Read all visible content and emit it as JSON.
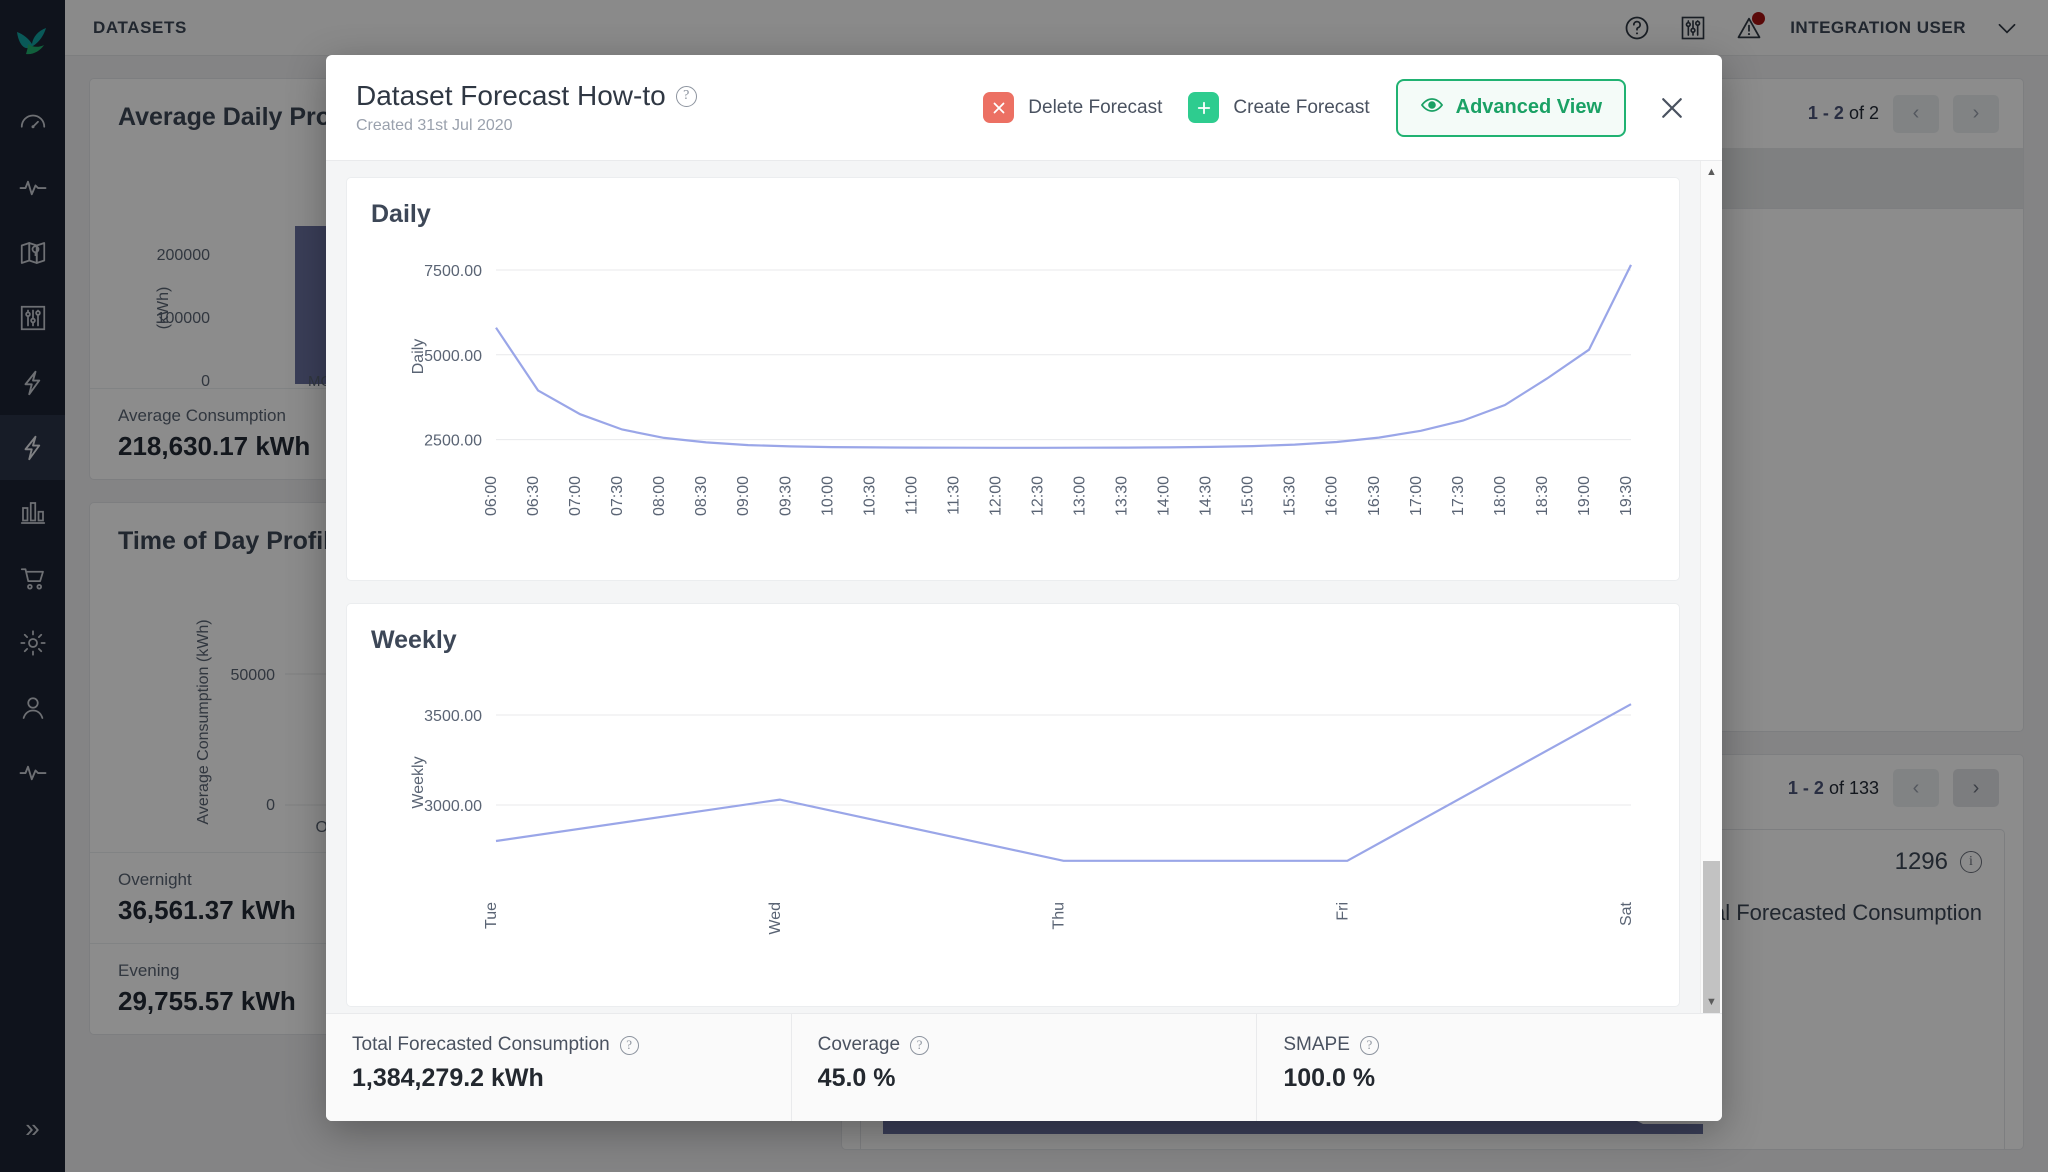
{
  "topbar": {
    "breadcrumb": "DATASETS",
    "user": "INTEGRATION USER",
    "icons": [
      "help-icon",
      "settings-sliders-icon",
      "alert-warning-icon",
      "chevron-down-icon"
    ]
  },
  "sidebar": {
    "items": [
      {
        "name": "logo",
        "label": "Logo"
      },
      {
        "name": "dashboard",
        "label": "Dashboard"
      },
      {
        "name": "activity",
        "label": "Activity"
      },
      {
        "name": "map",
        "label": "Map"
      },
      {
        "name": "controls",
        "label": "Controls"
      },
      {
        "name": "energy",
        "label": "Energy"
      },
      {
        "name": "datasets",
        "label": "Datasets"
      },
      {
        "name": "reports",
        "label": "Reports"
      },
      {
        "name": "marketplace",
        "label": "Marketplace"
      },
      {
        "name": "settings",
        "label": "Settings"
      },
      {
        "name": "users",
        "label": "Users"
      },
      {
        "name": "monitoring",
        "label": "Monitoring"
      }
    ],
    "expand_label": "»"
  },
  "background": {
    "card1": {
      "title": "Average Daily Profile",
      "stat_label": "Average Consumption",
      "stat_value": "218,630.17 kWh",
      "y_ticks": [
        "200000",
        "100000",
        "0"
      ],
      "y_axis": "(kWh)",
      "x_tick": "MON"
    },
    "card2": {
      "title": "Time of Day Profile",
      "y_ticks": [
        "50000",
        "0"
      ],
      "y_axis": "Average Consumption (kWh)",
      "x_tick": "OVERNIGHT",
      "stats": [
        {
          "label": "Overnight",
          "value": "36,561.37 kWh"
        },
        {
          "label": "Evening",
          "value": "29,755.57 kWh"
        }
      ]
    },
    "pager1": {
      "range": "1 - 2",
      "total": "of 2"
    },
    "pager2": {
      "range": "1 - 2",
      "total": "of 133"
    },
    "create_forecast_chip": "Create Forecast",
    "count_badge": "1296",
    "right_card_title": "Total Forecasted Consumption"
  },
  "modal": {
    "title": "Dataset Forecast How-to",
    "subtitle": "Created 31st Jul 2020",
    "delete_label": "Delete Forecast",
    "create_label": "Create Forecast",
    "advanced_label": "Advanced View",
    "close_label": "×",
    "footer": [
      {
        "label": "Total Forecasted Consumption",
        "value": "1,384,279.2 kWh"
      },
      {
        "label": "Coverage",
        "value": "45.0 %"
      },
      {
        "label": "SMAPE",
        "value": "100.0 %"
      }
    ]
  },
  "chart_data": [
    {
      "type": "line",
      "title": "Daily",
      "ylabel": "Daily",
      "xlabel": "",
      "grid": true,
      "legend": "none",
      "yticks": [
        "2500.00",
        "5000.00",
        "7500.00"
      ],
      "ylim": [
        1900,
        8000
      ],
      "x": [
        "06:00",
        "06:30",
        "07:00",
        "07:30",
        "08:00",
        "08:30",
        "09:00",
        "09:30",
        "10:00",
        "10:30",
        "11:00",
        "11:30",
        "12:00",
        "12:30",
        "13:00",
        "13:30",
        "14:00",
        "14:30",
        "15:00",
        "15:30",
        "16:00",
        "16:30",
        "17:00",
        "17:30",
        "18:00",
        "18:30",
        "19:00",
        "19:30"
      ],
      "values": [
        5800,
        3950,
        3250,
        2800,
        2550,
        2420,
        2340,
        2300,
        2280,
        2270,
        2265,
        2262,
        2260,
        2260,
        2262,
        2265,
        2272,
        2285,
        2310,
        2355,
        2430,
        2560,
        2760,
        3060,
        3520,
        4300,
        5150,
        7650
      ]
    },
    {
      "type": "line",
      "title": "Weekly",
      "ylabel": "Weekly",
      "xlabel": "",
      "grid": true,
      "legend": "none",
      "yticks": [
        "3000.00",
        "3500.00"
      ],
      "ylim": [
        2550,
        3700
      ],
      "x": [
        "Tue",
        "Wed",
        "Thu",
        "Fri",
        "Sat"
      ],
      "values": [
        2800,
        3030,
        2690,
        2690,
        3560
      ]
    }
  ]
}
